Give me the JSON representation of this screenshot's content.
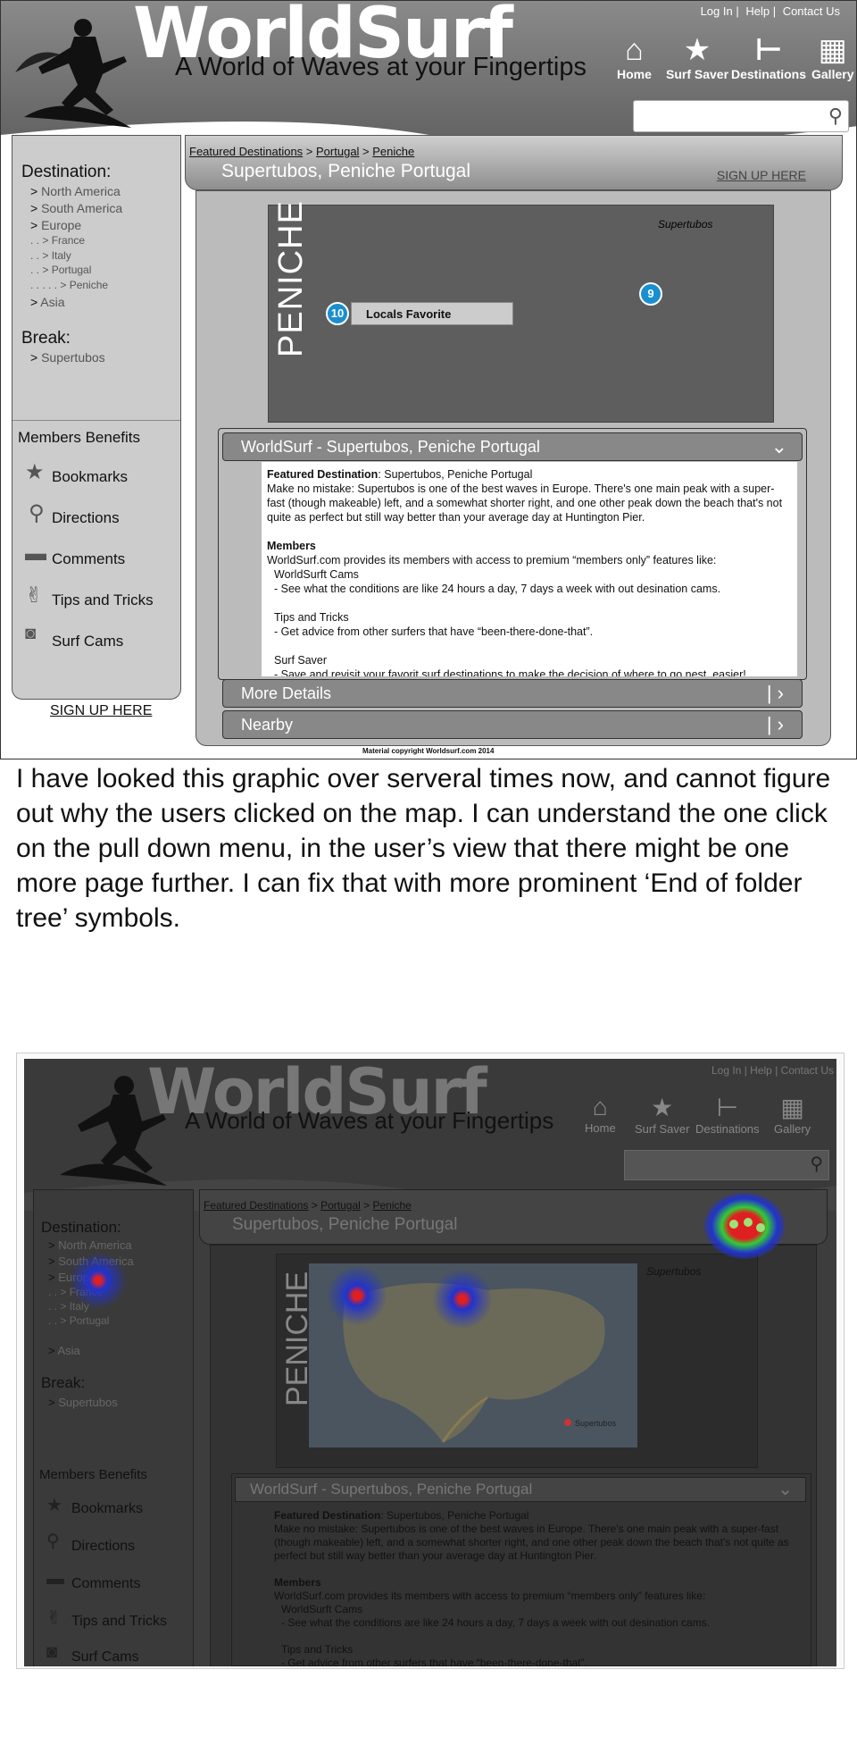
{
  "header": {
    "logo_title": "WorldSurf",
    "tagline": "A World of Waves at your Fingertips",
    "top_links": [
      "Log In",
      "Help",
      "Contact Us"
    ],
    "nav": [
      {
        "label": "Home",
        "icon": "home-icon"
      },
      {
        "label": "Surf Saver",
        "icon": "star-icon"
      },
      {
        "label": "Destinations",
        "icon": "signpost-icon"
      },
      {
        "label": "Gallery",
        "icon": "grid-icon"
      }
    ],
    "search_placeholder": ""
  },
  "sidebar": {
    "destination_heading": "Destination:",
    "destinations": [
      {
        "prefix": "> ",
        "label": "North America"
      },
      {
        "prefix": "> ",
        "label": "South America"
      },
      {
        "prefix": "> ",
        "label": "Europe"
      },
      {
        "prefix": ". . > ",
        "label": "France"
      },
      {
        "prefix": ". . > ",
        "label": "Italy"
      },
      {
        "prefix": ". . > ",
        "label": "Portugal"
      },
      {
        "prefix": ". . . . . > ",
        "label": "Peniche"
      },
      {
        "prefix": "> ",
        "label": "Asia"
      }
    ],
    "break_heading": "Break:",
    "break_item": {
      "prefix": "> ",
      "label": "Supertubos"
    },
    "members_heading": "Members Benefits",
    "benefits": [
      {
        "label": "Bookmarks",
        "icon": "star-icon"
      },
      {
        "label": "Directions",
        "icon": "map-pin-icon"
      },
      {
        "label": "Comments",
        "icon": "speech-bubble-icon"
      },
      {
        "label": "Tips and Tricks",
        "icon": "shaka-hand-icon"
      },
      {
        "label": "Surf Cams",
        "icon": "camera-icon"
      }
    ],
    "signup": "SIGN UP HERE"
  },
  "main": {
    "breadcrumb": [
      "Featured Destinations",
      "Portugal",
      "Peniche"
    ],
    "page_title": "Supertubos, Peniche Portugal",
    "signup": "SIGN UP HERE",
    "map": {
      "vertical_label": "PENICHE",
      "spot_name": "Supertubos",
      "markers": [
        {
          "number": "10"
        },
        {
          "number": "9"
        }
      ],
      "tooltip": "Locals Favorite"
    },
    "accordion": {
      "open_title": "WorldSurf  - Supertubos, Peniche Portugal",
      "featured_label": "Featured Destination",
      "featured_value": ": Supertubos, Peniche Portugal",
      "featured_text": "Make no mistake: Supertubos is one of the best waves in Europe. There's one main peak with a super-fast (though makeable) left, and a somewhat shorter right, and one other peak down the beach that's not quite as perfect but still way better than your average day at Huntington Pier.",
      "members_label": "Members",
      "members_text": "WorldSurf.com provides its members with access to premium “members only” features like:",
      "features": [
        {
          "title": "WorldSurft Cams",
          "desc": "- See what the conditions are like 24 hours a day, 7 days a week with out desination cams."
        },
        {
          "title": "Tips and Tricks",
          "desc": "- Get advice from other surfers that have “been-there-done-that”."
        },
        {
          "title": "Surf Saver",
          "desc": "- Save and revisit your favorit surf destinations to make the decision of where to go nest, easier!"
        }
      ],
      "more_details": "More Details",
      "nearby": "Nearby"
    },
    "copyright": "Material copyright Worldsurf.com 2014"
  },
  "comment": "I have looked this graphic over serveral times now, and cannot figure out why the users clicked on the map. I can understand the one click on the pull down menu, in the user’s view that there might  be one more page further. I can fix that with more prominent ‘End of folder tree’ symbols.",
  "heatmap_mock": {
    "map_labels": [
      "Supertubos"
    ],
    "features": [
      {
        "title": "WorldSurft Cams",
        "desc": "- See what the conditions are like 24 hours a day, 7 days a week with out desination cams."
      },
      {
        "title": "Tips and Tricks",
        "desc": "- Get advice from other surfers that have “been-there-done-that”."
      }
    ],
    "surf_cams_partial": "Surf Cams"
  },
  "colors": {
    "header_gray": "#6f6f6f",
    "marker_blue": "#1a8fd0",
    "heat_red": "#e02020",
    "heat_blue": "#2233cc",
    "heat_green": "#33cc33"
  }
}
